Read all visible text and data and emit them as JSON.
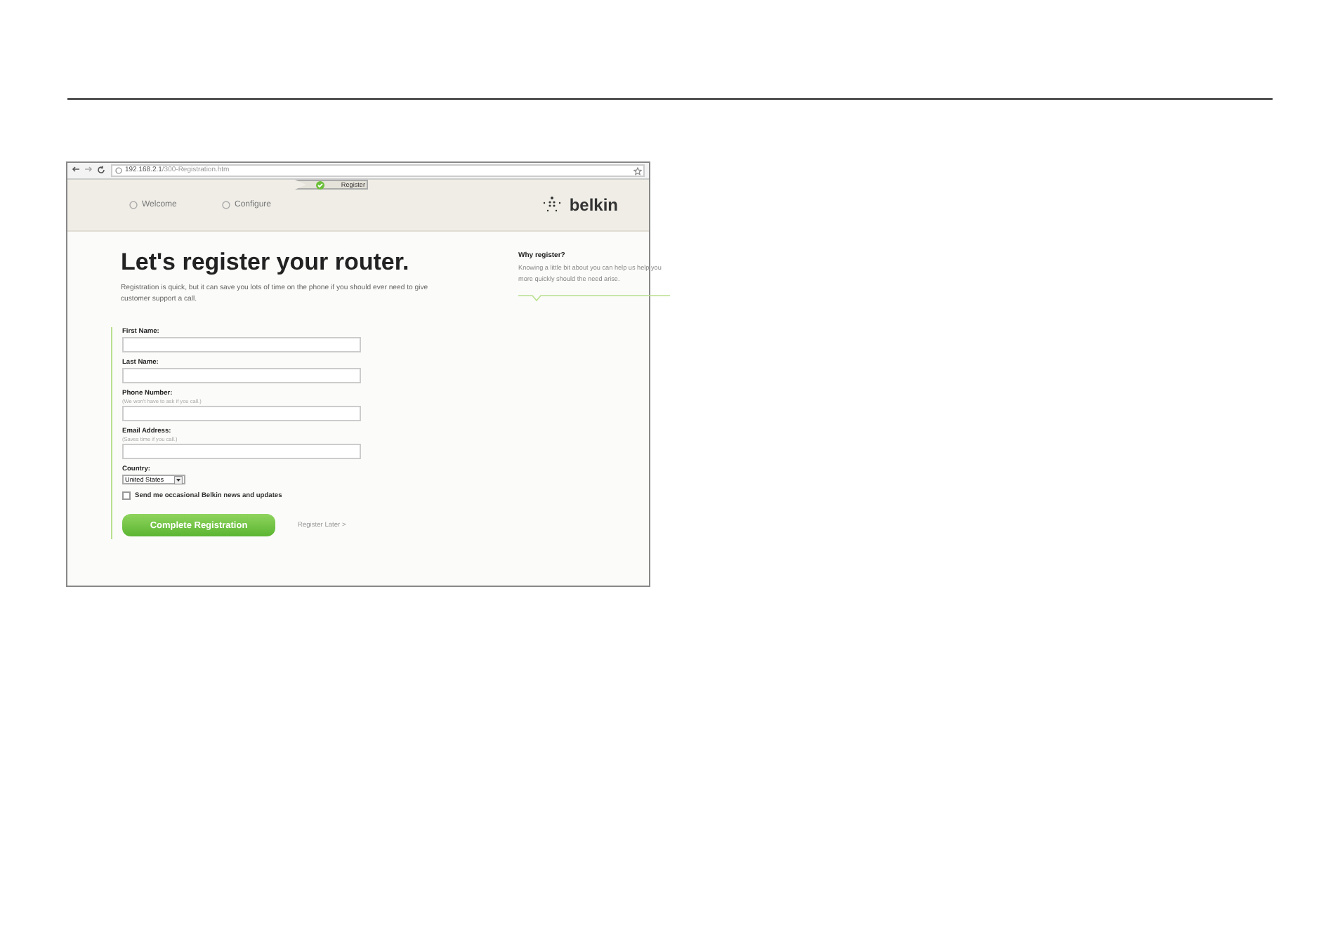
{
  "browser": {
    "url_host": "192.168.2.1",
    "url_path": "/300-Registration.htm"
  },
  "steps": [
    {
      "label": "Welcome",
      "selected": false
    },
    {
      "label": "Configure",
      "selected": false
    },
    {
      "label": "Register",
      "selected": true
    }
  ],
  "logo": "belkin",
  "heading": "Let's register your router.",
  "intro": "Registration is quick, but it can save you lots of time on the phone if you should ever need to give customer support a call.",
  "fields": [
    {
      "kind": "text",
      "label": "First Name:"
    },
    {
      "kind": "text",
      "label": "Last Name:"
    },
    {
      "kind": "text",
      "label": "Phone Number:",
      "hint": "(We won't have to ask if you call.)"
    },
    {
      "kind": "text",
      "label": "Email Address:",
      "hint": "(Saves time if you call.)"
    },
    {
      "kind": "select",
      "label": "Country:",
      "value": "United States"
    }
  ],
  "newsletter": {
    "label": "Send me occasional Belkin news and updates",
    "checked": false
  },
  "submit": "Complete Registration",
  "later": "Register Later >",
  "aside": {
    "title": "Why register?",
    "text": "Knowing a little bit about you can help us help you more quickly should the need arise."
  }
}
